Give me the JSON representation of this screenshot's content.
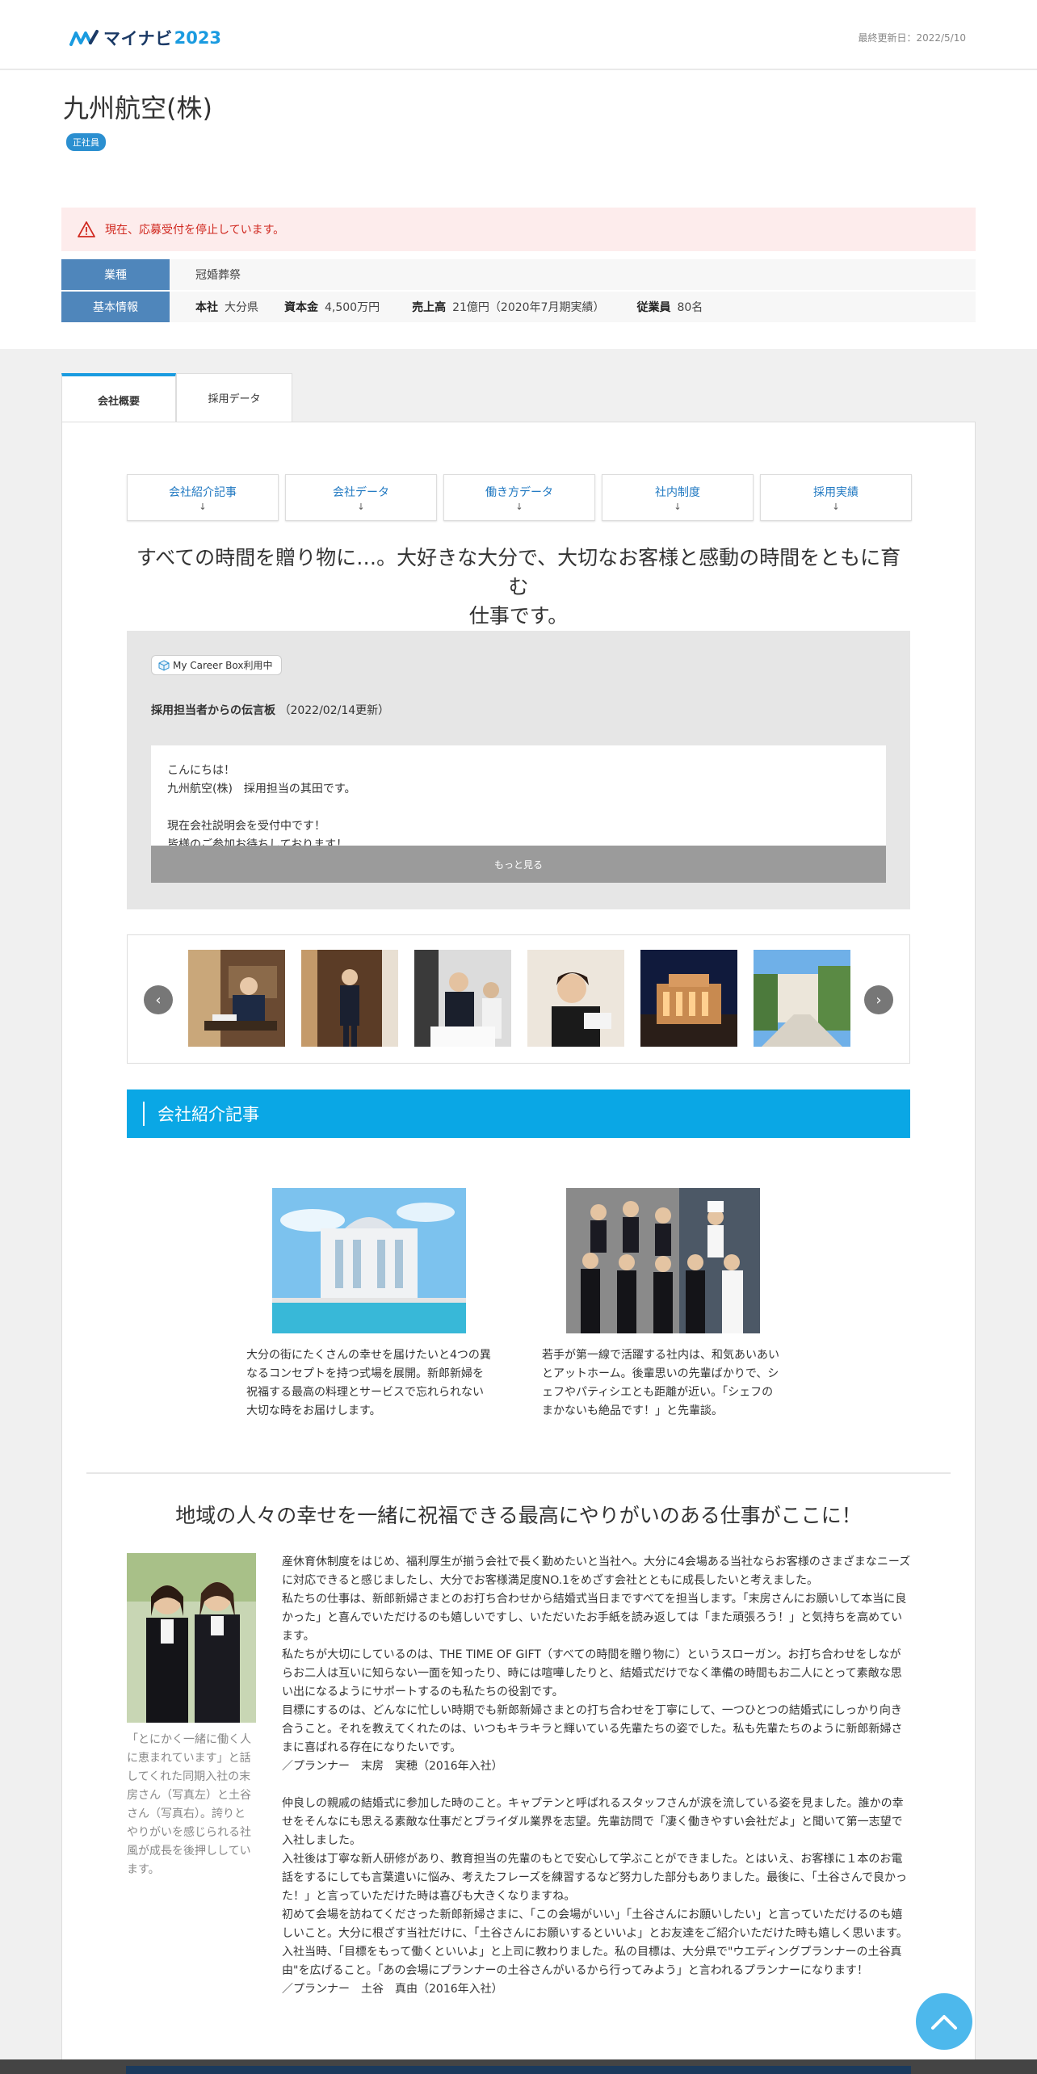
{
  "header": {
    "logo_text": "マイナビ",
    "logo_year": "2023",
    "last_updated": "最終更新日：2022/5/10"
  },
  "company": {
    "name": "九州航空(株)",
    "badge": "正社員",
    "alert": "現在、応募受付を停止しています。",
    "industry_label": "業種",
    "industry_value": "冠婚葬祭",
    "basic_label": "基本情報",
    "basic": [
      {
        "key": "本社",
        "value": "大分県"
      },
      {
        "key": "資本金",
        "value": "4,500万円"
      },
      {
        "key": "売上高",
        "value": "21億円（2020年7月期実績）"
      },
      {
        "key": "従業員",
        "value": "80名"
      }
    ]
  },
  "tabs": [
    {
      "label": "会社概要",
      "active": true
    },
    {
      "label": "採用データ",
      "active": false
    }
  ],
  "anchor_nav": [
    {
      "label": "会社紹介記事",
      "arrow": "↓"
    },
    {
      "label": "会社データ",
      "arrow": "↓"
    },
    {
      "label": "働き方データ",
      "arrow": "↓"
    },
    {
      "label": "社内制度",
      "arrow": "↓"
    },
    {
      "label": "採用実績",
      "arrow": "↓"
    }
  ],
  "catch_line1": "すべての時間を贈り物に…。大好きな大分で、大切なお客様と感動の時間をともに育む",
  "catch_line2": "仕事です。",
  "message_board": {
    "badge": "My Career Box利用中",
    "title": "採用担当者からの伝言板",
    "updated": "（2022/02/14更新）",
    "lines": [
      "こんにちは！",
      "九州航空(株)　採用担当の其田です。",
      "",
      "現在会社説明会を受付中です！",
      "皆様のご参加お待ちしております！"
    ],
    "more": "もっと見る"
  },
  "slider": {
    "prev": "‹",
    "next": "›"
  },
  "section_title": "会社紹介記事",
  "articles": [
    {
      "text": "大分の街にたくさんの幸せを届けたいと4つの異なるコンセプトを持つ式場を展開。新郎新婦を祝福する最高の料理とサービスで忘れられない大切な時をお届けします。"
    },
    {
      "text": "若手が第一線で活躍する社内は、和気あいあいとアットホーム。後輩思いの先輩ばかりで、シェフやパティシエとも距離が近い。「シェフのまかないも絶品です！」と先輩談。"
    }
  ],
  "story": {
    "title": "地域の人々の幸せを一緒に祝福できる最高にやりがいのある仕事がここに！",
    "caption": "「とにかく一緒に働く人に恵まれています」と話してくれた同期入社の末房さん（写真左）と土谷さん（写真右）。誇りとやりがいを感じられる社風が成長を後押ししています。",
    "paragraphs": [
      "産休育休制度をはじめ、福利厚生が揃う会社で長く勤めたいと当社へ。大分に4会場ある当社ならお客様のさまざまなニーズに対応できると感じましたし、大分でお客様満足度NO.1をめざす会社とともに成長したいと考えました。",
      "私たちの仕事は、新郎新婦さまとのお打ち合わせから結婚式当日まですべてを担当します。「末房さんにお願いして本当に良かった」と喜んでいただけるのも嬉しいですし、いただいたお手紙を読み返しては「また頑張ろう！」と気持ちを高めています。",
      "私たちが大切にしているのは、THE TIME OF GIFT（すべての時間を贈り物に）というスローガン。お打ち合わせをしながらお二人は互いに知らない一面を知ったり、時には喧嘩したりと、結婚式だけでなく準備の時間もお二人にとって素敵な思い出になるようにサポートするのも私たちの役割です。",
      "目標にするのは、どんなに忙しい時期でも新郎新婦さまとの打ち合わせを丁寧にして、一つひとつの結婚式にしっかり向き合うこと。それを教えてくれたのは、いつもキラキラと輝いている先輩たちの姿でした。私も先輩たちのように新郎新婦さまに喜ばれる存在になりたいです。",
      "／プランナー　末房　実穂（2016年入社）",
      "",
      "仲良しの親戚の結婚式に参加した時のこと。キャプテンと呼ばれるスタッフさんが涙を流している姿を見ました。誰かの幸せをそんなにも思える素敵な仕事だとブライダル業界を志望。先輩訪問で「凄く働きやすい会社だよ」と聞いて第一志望で入社しました。",
      "入社後は丁寧な新人研修があり、教育担当の先輩のもとで安心して学ぶことができました。とはいえ、お客様に１本のお電話をするにしても言葉遣いに悩み、考えたフレーズを練習するなど努力した部分もありました。最後に、「土谷さんで良かった！」と言っていただけた時は喜びも大きくなりますね。",
      "初めて会場を訪ねてくださった新郎新婦さまに、「この会場がいい」「土谷さんにお願いしたい」と言っていただけるのも嬉しいこと。大分に根ざす当社だけに、「土谷さんにお願いするといいよ」とお友達をご紹介いただけた時も嬉しく思います。",
      "入社当時、「目標をもって働くといいよ」と上司に教わりました。私の目標は、大分県で\"ウエディングプランナーの土谷真由\"を広げること。「あの会場にプランナーの土谷さんがいるから行ってみよう」と言われるプランナーになります！",
      "／プランナー　土谷　真由（2016年入社）"
    ]
  },
  "colors": {
    "brand": "#1a9be0",
    "section_bar": "#0aa7e5",
    "info_label": "#4f86bb",
    "alert_bg": "#fdecec",
    "alert_text": "#d0281f"
  }
}
